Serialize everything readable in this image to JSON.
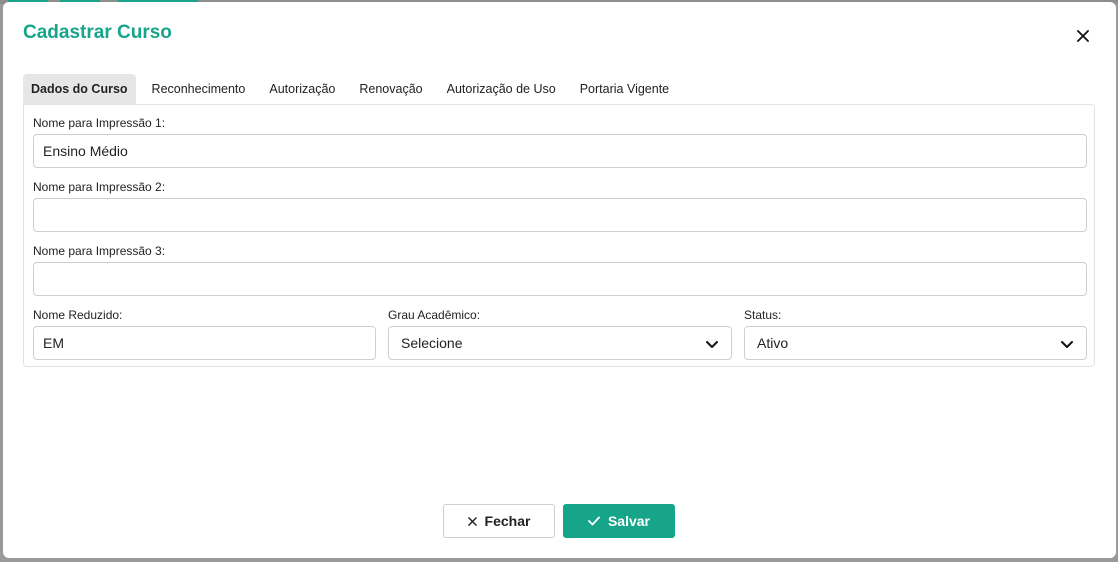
{
  "modal": {
    "title": "Cadastrar Curso"
  },
  "tabs": [
    {
      "label": "Dados do Curso",
      "active": true
    },
    {
      "label": "Reconhecimento",
      "active": false
    },
    {
      "label": "Autorização",
      "active": false
    },
    {
      "label": "Renovação",
      "active": false
    },
    {
      "label": "Autorização de Uso",
      "active": false
    },
    {
      "label": "Portaria Vigente",
      "active": false
    }
  ],
  "form": {
    "nome1": {
      "label": "Nome para Impressão 1:",
      "value": "Ensino Médio"
    },
    "nome2": {
      "label": "Nome para Impressão 2:",
      "value": ""
    },
    "nome3": {
      "label": "Nome para Impressão 3:",
      "value": ""
    },
    "nome_reduzido": {
      "label": "Nome Reduzido:",
      "value": "EM"
    },
    "grau": {
      "label": "Grau Acadêmico:",
      "selected": "Selecione"
    },
    "status": {
      "label": "Status:",
      "selected": "Ativo"
    }
  },
  "footer": {
    "close_label": "Fechar",
    "save_label": "Salvar"
  },
  "colors": {
    "accent": "#17a58a"
  }
}
